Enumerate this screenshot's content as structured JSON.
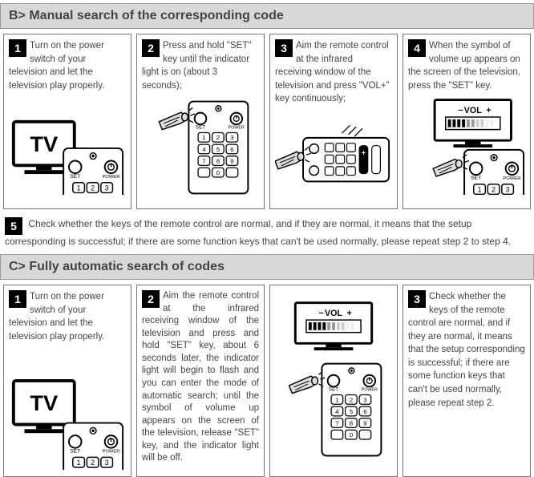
{
  "sectionB": {
    "heading": "B> Manual search of the corresponding code",
    "steps": [
      {
        "num": "1",
        "text": "Turn on the power switch of your television and let the television play properly."
      },
      {
        "num": "2",
        "text": "Press and hold \"SET\" key until the indicator light is on (about 3 seconds);"
      },
      {
        "num": "3",
        "text": "Aim the remote control at the infrared receiving window of the television and press \"VOL+\" key continuously;"
      },
      {
        "num": "4",
        "text": "When the symbol of volume up appears on the screen of the television, press the \"SET\" key."
      },
      {
        "num": "5",
        "text": "Check whether the keys of the remote control are normal, and if they are normal, it means that the setup corresponding is successful; if there are some function keys that can't be used normally, please repeat step 2 to step 4."
      }
    ]
  },
  "sectionC": {
    "heading": "C> Fully automatic search of codes",
    "steps": [
      {
        "num": "1",
        "text": "Turn on the power switch of your television and let the television play properly."
      },
      {
        "num": "2",
        "text": "Aim the remote control at the infrared receiving window of the television and press and hold \"SET\" key, about 6 seconds later, the indicator light will begin to flash and you can enter the mode of automatic search; until the symbol of volume up appears on the screen of the television, release \"SET\" key, and the indicator light will be off."
      },
      {
        "num": "3",
        "text": "Check whether the keys of the remote control are normal, and if they are normal, it means that the setup corresponding is successful; if there are some function keys that can't be used normally, please repeat step 2."
      }
    ]
  },
  "labels": {
    "tv": "TV",
    "set": "SET",
    "power": "POWER",
    "vol": "VOL",
    "minus": "−",
    "plus": "+"
  }
}
